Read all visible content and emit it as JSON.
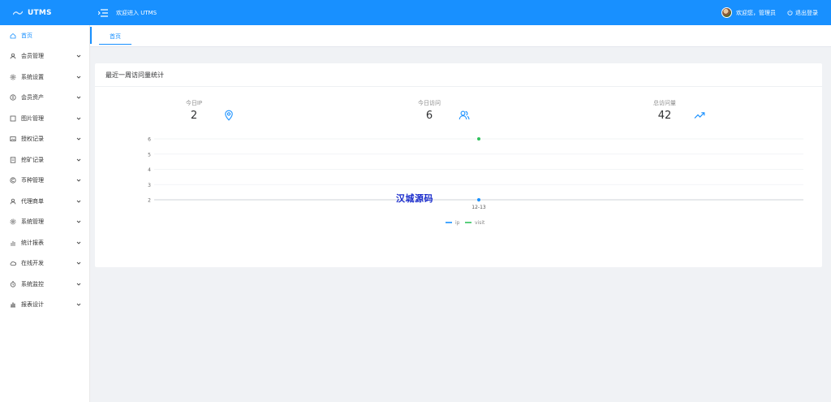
{
  "header": {
    "app_name": "UTMS",
    "welcome_text": "欢迎进入 UTMS",
    "user_greeting": "欢迎您，管理员",
    "logout_label": "退出登录",
    "brand_color": "#1890ff"
  },
  "sidebar": {
    "items": [
      {
        "label": "首页",
        "icon": "home-icon",
        "active": true,
        "expandable": false
      },
      {
        "label": "会员管理",
        "icon": "user-icon",
        "expandable": true
      },
      {
        "label": "系统设置",
        "icon": "gear-icon",
        "expandable": true
      },
      {
        "label": "会员资产",
        "icon": "coin-icon",
        "expandable": true
      },
      {
        "label": "图片管理",
        "icon": "square-icon",
        "expandable": true
      },
      {
        "label": "授权记录",
        "icon": "image-icon",
        "expandable": true
      },
      {
        "label": "挖矿记录",
        "icon": "document-icon",
        "expandable": true
      },
      {
        "label": "币种管理",
        "icon": "copyright-icon",
        "expandable": true
      },
      {
        "label": "代理商单",
        "icon": "user-icon",
        "expandable": true
      },
      {
        "label": "系统管理",
        "icon": "gear-icon",
        "expandable": true
      },
      {
        "label": "统计报表",
        "icon": "bar-chart-icon",
        "expandable": true
      },
      {
        "label": "在线开发",
        "icon": "cloud-icon",
        "expandable": true
      },
      {
        "label": "系统监控",
        "icon": "timer-icon",
        "expandable": true
      },
      {
        "label": "报表设计",
        "icon": "chart-icon",
        "expandable": true
      }
    ]
  },
  "tabs": [
    {
      "label": "首页",
      "active": true
    }
  ],
  "card": {
    "title": "最近一周访问量统计",
    "stats": [
      {
        "label": "今日IP",
        "value": "2",
        "icon": "location-icon"
      },
      {
        "label": "今日访问",
        "value": "6",
        "icon": "users-icon"
      },
      {
        "label": "总访问量",
        "value": "42",
        "icon": "trend-up-icon"
      }
    ]
  },
  "chart_data": {
    "type": "scatter",
    "x": [
      "12-13"
    ],
    "series": [
      {
        "name": "ip",
        "values": [
          2
        ],
        "color": "#1890ff"
      },
      {
        "name": "visit",
        "values": [
          6
        ],
        "color": "#2fc25b"
      }
    ],
    "yticks": [
      2,
      3,
      4,
      5,
      6
    ],
    "ylim": [
      2,
      6
    ],
    "grid": true,
    "legend_position": "bottom-center"
  },
  "watermark": "汉城源码"
}
